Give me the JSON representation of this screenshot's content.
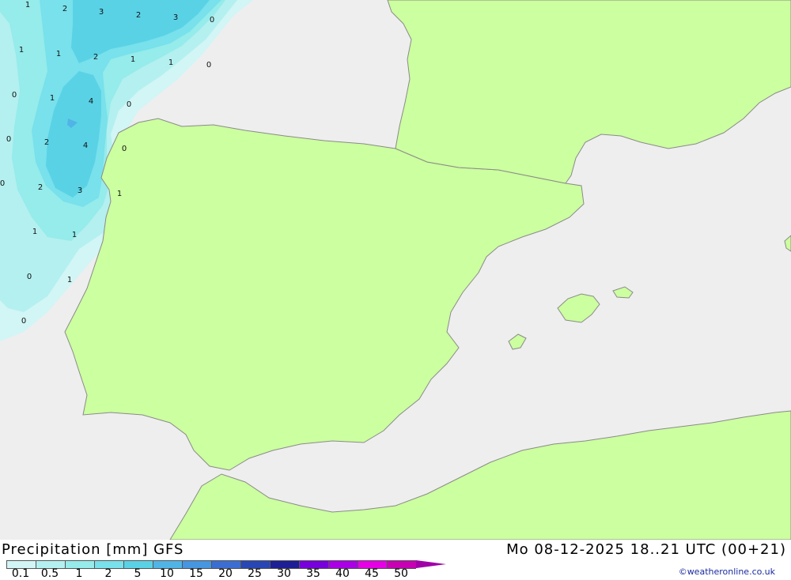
{
  "colors": {
    "sea": "#eeeeee",
    "land": "#ccff9f",
    "coast": "#8a8a8a"
  },
  "map": {
    "values": [
      {
        "t": "1"
      },
      {
        "t": "2"
      },
      {
        "t": "3"
      },
      {
        "t": "2"
      },
      {
        "t": "3"
      },
      {
        "t": "0"
      },
      {
        "t": "1"
      },
      {
        "t": "1"
      },
      {
        "t": "2"
      },
      {
        "t": "1"
      },
      {
        "t": "1"
      },
      {
        "t": "0"
      },
      {
        "t": "0"
      },
      {
        "t": "1"
      },
      {
        "t": "4"
      },
      {
        "t": "0"
      },
      {
        "t": "0"
      },
      {
        "t": "2"
      },
      {
        "t": "4"
      },
      {
        "t": "0"
      },
      {
        "t": "0"
      },
      {
        "t": "2"
      },
      {
        "t": "3"
      },
      {
        "t": "1"
      },
      {
        "t": "1"
      },
      {
        "t": "1"
      },
      {
        "t": "0"
      },
      {
        "t": "1"
      },
      {
        "t": "0"
      }
    ]
  },
  "footer": {
    "title": "Precipitation [mm] GFS",
    "datetime": "Mo 08-12-2025 18..21 UTC (00+21)",
    "credit": "©weatheronline.co.uk"
  },
  "legend": {
    "ticks": [
      "0.1",
      "0.5",
      "1",
      "2",
      "5",
      "10",
      "15",
      "20",
      "25",
      "30",
      "35",
      "40",
      "45",
      "50"
    ],
    "colors": [
      "#d2f5f5",
      "#b4f0f0",
      "#96ebeb",
      "#78e1eb",
      "#5ad2e6",
      "#50b4e6",
      "#4696e1",
      "#3c6ed2",
      "#2846b4",
      "#1e1e96",
      "#7800dc",
      "#aa00e6",
      "#e600e6",
      "#c800b4"
    ]
  }
}
